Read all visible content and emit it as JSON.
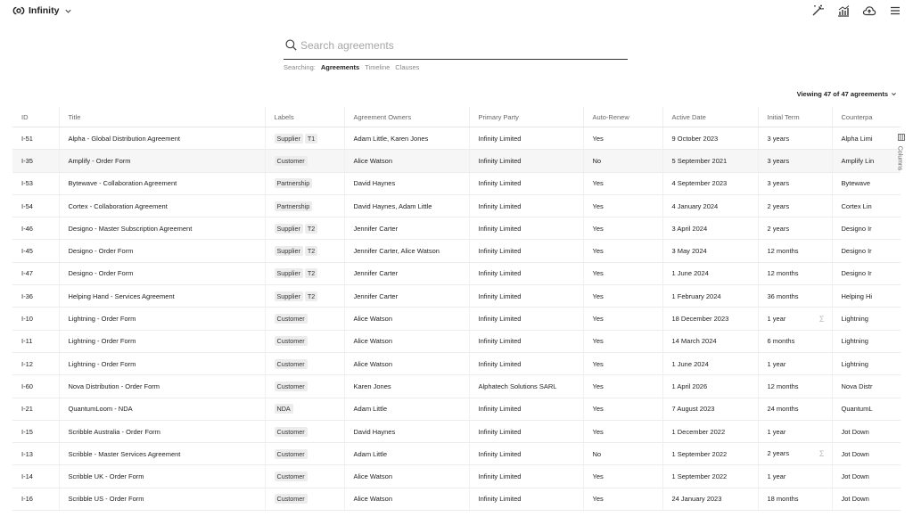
{
  "app": {
    "name": "Infinity"
  },
  "search": {
    "placeholder": "Search agreements",
    "searching_label": "Searching:",
    "options": [
      {
        "label": "Agreements",
        "active": true
      },
      {
        "label": "Timeline",
        "active": false
      },
      {
        "label": "Clauses",
        "active": false
      }
    ]
  },
  "viewing": "Viewing 47 of 47 agreements",
  "columns_tab": "Columns",
  "table": {
    "headers": [
      "ID",
      "Title",
      "Labels",
      "Agreement Owners",
      "Primary Party",
      "Auto-Renew",
      "Active Date",
      "Initial Term",
      "Counterpa"
    ],
    "rows": [
      {
        "id": "I-51",
        "title": "Alpha - Global Distribution Agreement",
        "labels": [
          "Supplier",
          "T1"
        ],
        "owners": "Adam Little, Karen Jones",
        "party": "Infinity Limited",
        "renew": "Yes",
        "date": "9 October 2023",
        "term": "3 years",
        "counterparty": "Alpha Limi",
        "sigma": false
      },
      {
        "id": "I-35",
        "title": "Amplify - Order Form",
        "labels": [
          "Customer"
        ],
        "owners": "Alice Watson",
        "party": "Infinity Limited",
        "renew": "No",
        "date": "5 September 2021",
        "term": "3 years",
        "counterparty": "Amplify Lin",
        "sigma": false
      },
      {
        "id": "I-53",
        "title": "Bytewave - Collaboration Agreement",
        "labels": [
          "Partnership"
        ],
        "owners": "David Haynes",
        "party": "Infinity Limited",
        "renew": "Yes",
        "date": "4 September 2023",
        "term": "3 years",
        "counterparty": "Bytewave",
        "sigma": false
      },
      {
        "id": "I-54",
        "title": "Cortex - Collaboration Agreement",
        "labels": [
          "Partnership"
        ],
        "owners": "David Haynes, Adam Little",
        "party": "Infinity Limited",
        "renew": "Yes",
        "date": "4 January 2024",
        "term": "2 years",
        "counterparty": "Cortex Lin",
        "sigma": false
      },
      {
        "id": "I-46",
        "title": "Designo - Master Subscription Agreement",
        "labels": [
          "Supplier",
          "T2"
        ],
        "owners": "Jennifer Carter",
        "party": "Infinity Limited",
        "renew": "Yes",
        "date": "3 April 2024",
        "term": "2 years",
        "counterparty": "Designo Ir",
        "sigma": false
      },
      {
        "id": "I-45",
        "title": "Designo - Order Form",
        "labels": [
          "Supplier",
          "T2"
        ],
        "owners": "Jennifer Carter, Alice Watson",
        "party": "Infinity Limited",
        "renew": "Yes",
        "date": "3 May 2024",
        "term": "12 months",
        "counterparty": "Designo Ir",
        "sigma": false
      },
      {
        "id": "I-47",
        "title": "Designo - Order Form",
        "labels": [
          "Supplier",
          "T2"
        ],
        "owners": "Jennifer Carter",
        "party": "Infinity Limited",
        "renew": "Yes",
        "date": "1 June 2024",
        "term": "12 months",
        "counterparty": "Designo Ir",
        "sigma": false
      },
      {
        "id": "I-36",
        "title": "Helping Hand - Services Agreement",
        "labels": [
          "Supplier",
          "T2"
        ],
        "owners": "Jennifer Carter",
        "party": "Infinity Limited",
        "renew": "Yes",
        "date": "1 February 2024",
        "term": "36 months",
        "counterparty": "Helping Hi",
        "sigma": false
      },
      {
        "id": "I-10",
        "title": "Lightning - Order Form",
        "labels": [
          "Customer"
        ],
        "owners": "Alice Watson",
        "party": "Infinity Limited",
        "renew": "Yes",
        "date": "18 December 2023",
        "term": "1 year",
        "counterparty": "Lightning",
        "sigma": true
      },
      {
        "id": "I-11",
        "title": "Lightning - Order Form",
        "labels": [
          "Customer"
        ],
        "owners": "Alice Watson",
        "party": "Infinity Limited",
        "renew": "Yes",
        "date": "14 March 2024",
        "term": "6 months",
        "counterparty": "Lightning",
        "sigma": false
      },
      {
        "id": "I-12",
        "title": "Lightning - Order Form",
        "labels": [
          "Customer"
        ],
        "owners": "Alice Watson",
        "party": "Infinity Limited",
        "renew": "Yes",
        "date": "1 June 2024",
        "term": "1 year",
        "counterparty": "Lightning",
        "sigma": false
      },
      {
        "id": "I-60",
        "title": "Nova Distribution - Order Form",
        "labels": [
          "Customer"
        ],
        "owners": "Karen Jones",
        "party": "Alphatech Solutions SARL",
        "renew": "Yes",
        "date": "1 April 2026",
        "term": "12 months",
        "counterparty": "Nova Distr",
        "sigma": false
      },
      {
        "id": "I-21",
        "title": "QuantumLoom - NDA",
        "labels": [
          "NDA"
        ],
        "owners": "Adam Little",
        "party": "Infinity Limited",
        "renew": "Yes",
        "date": "7 August 2023",
        "term": "24 months",
        "counterparty": "QuantumL",
        "sigma": false
      },
      {
        "id": "I-15",
        "title": "Scribble Australia - Order Form",
        "labels": [
          "Customer"
        ],
        "owners": "David Haynes",
        "party": "Infinity Limited",
        "renew": "Yes",
        "date": "1 December 2022",
        "term": "1 year",
        "counterparty": "Jot Down",
        "sigma": false
      },
      {
        "id": "I-13",
        "title": "Scribble - Master Services Agreement",
        "labels": [
          "Customer"
        ],
        "owners": "Adam Little",
        "party": "Infinity Limited",
        "renew": "No",
        "date": "1 September 2022",
        "term": "2 years",
        "counterparty": "Jot Down",
        "sigma": true
      },
      {
        "id": "I-14",
        "title": "Scribble UK - Order Form",
        "labels": [
          "Customer"
        ],
        "owners": "Alice Watson",
        "party": "Infinity Limited",
        "renew": "Yes",
        "date": "1 September 2022",
        "term": "1 year",
        "counterparty": "Jot Down",
        "sigma": false
      },
      {
        "id": "I-16",
        "title": "Scribble US - Order Form",
        "labels": [
          "Customer"
        ],
        "owners": "Alice Watson",
        "party": "Infinity Limited",
        "renew": "Yes",
        "date": "24 January 2023",
        "term": "18 months",
        "counterparty": "Jot Down",
        "sigma": false
      }
    ]
  },
  "icons": {
    "logo": "infinity-logo-icon",
    "magic": "magic-wand-icon",
    "analytics": "bar-chart-icon",
    "upload": "cloud-upload-icon",
    "menu": "menu-icon",
    "search": "search-icon",
    "columns": "columns-grid-icon"
  }
}
